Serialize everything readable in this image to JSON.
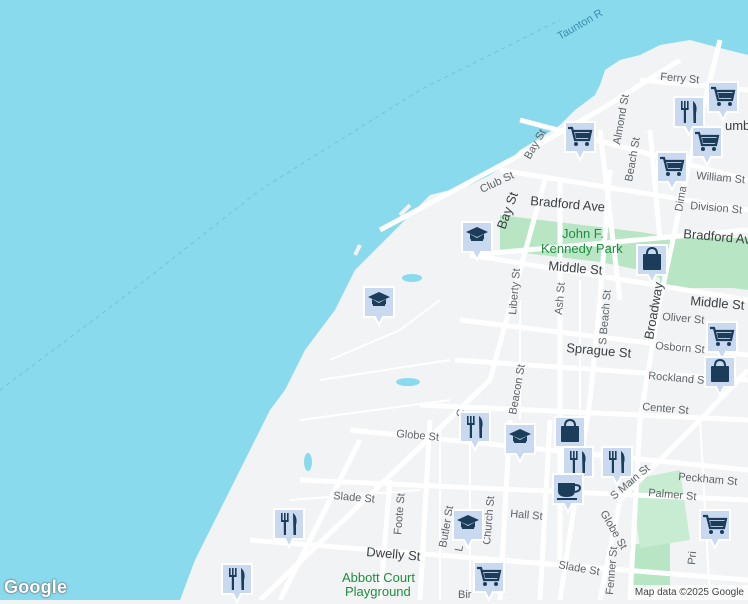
{
  "map": {
    "water_color": "#8adaed",
    "land_color": "#f1f3f4",
    "park_color": "#b8e6c4",
    "road_color": "#ffffff",
    "marker_color": "#c9d9f0",
    "icon_color": "#1c3d5a"
  },
  "labels": {
    "water": "Taunton R",
    "ferry_st": "Ferry St",
    "almond_st": "Almond St",
    "bay_st_n": "Bay St",
    "club_st": "Club St",
    "beach_st": "Beach St",
    "william_st": "William St",
    "division_st": "Division St",
    "dima": "Dima",
    "bradford_ave": "Bradford Ave",
    "bradford_ave_e": "Bradford Ave",
    "bay_st_s": "Bay St",
    "park_line1": "John F.",
    "park_line2": "Kennedy Park",
    "middle_st": "Middle St",
    "middle_st_e": "Middle St",
    "liberty_st": "Liberty St",
    "ash_st": "Ash St",
    "s_beach_st": "S Beach St",
    "broadway": "Broadway",
    "oliver_st": "Oliver St",
    "osborn_st": "Osborn St",
    "sprague_st": "Sprague St",
    "rockland_st": "Rockland St",
    "center_st": "Center St",
    "beacon_st": "Beacon St",
    "globe_st": "Globe St",
    "globe_st_s": "Globe St",
    "peckham_st": "Peckham St",
    "s_main_st": "S Main St",
    "palmer_st": "Palmer St",
    "slade_st": "Slade St",
    "slade_st_s": "Slade St",
    "foote_st": "Foote St",
    "church_st": "Church St",
    "hall_st": "Hall St",
    "butler_st": "Butler St",
    "dwelly_st": "Dwelly St",
    "fenner_st": "Fenner St",
    "playground_line1": "Abbott Court",
    "playground_line2": "Playground",
    "bir": "Bir",
    "c_label": "C",
    "l_label": "L",
    "pri": "Pri",
    "umb": "umb"
  },
  "markers": [
    {
      "type": "school-icon"
    },
    {
      "type": "school-icon"
    },
    {
      "type": "school-icon"
    },
    {
      "type": "school-icon"
    },
    {
      "type": "shopping-cart-icon"
    },
    {
      "type": "shopping-cart-icon"
    },
    {
      "type": "shopping-cart-icon"
    },
    {
      "type": "shopping-cart-icon"
    },
    {
      "type": "shopping-cart-icon"
    },
    {
      "type": "shopping-cart-icon"
    },
    {
      "type": "shopping-cart-icon"
    },
    {
      "type": "shopping-bag-icon"
    },
    {
      "type": "shopping-bag-icon"
    },
    {
      "type": "shopping-bag-icon"
    },
    {
      "type": "restaurant-icon"
    },
    {
      "type": "restaurant-icon"
    },
    {
      "type": "restaurant-icon"
    },
    {
      "type": "restaurant-icon"
    },
    {
      "type": "restaurant-icon"
    },
    {
      "type": "restaurant-icon"
    },
    {
      "type": "cafe-icon"
    }
  ],
  "footer": {
    "logo": "Google",
    "attribution": "Map data ©2025 Google"
  }
}
